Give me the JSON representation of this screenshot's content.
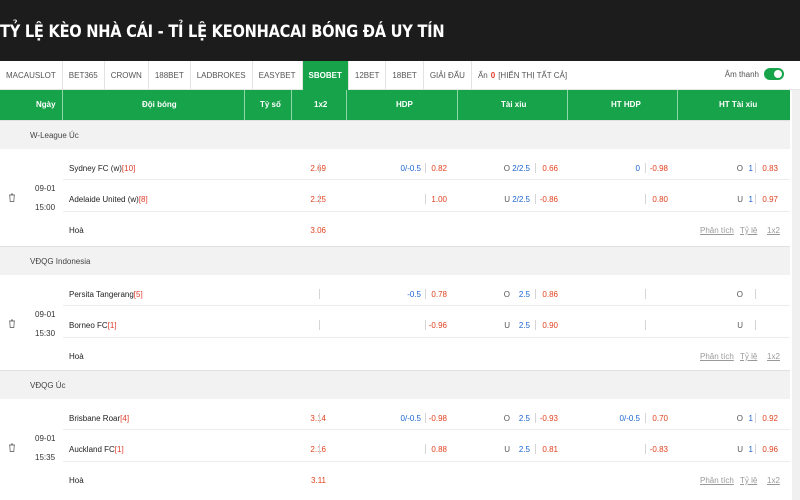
{
  "page": {
    "title": "TỶ LỆ KÈO NHÀ CÁI - TỈ LỆ KEONHACAI BÓNG ĐÁ UY TÍN"
  },
  "tabs": [
    "MACAUSLOT",
    "BET365",
    "CROWN",
    "188BET",
    "LADBROKES",
    "EASYBET",
    "SBOBET",
    "12BET",
    "18BET",
    "GIẢI ĐẤU"
  ],
  "hidden_tab": {
    "prefix": "Ẩn",
    "count": "0",
    "show_all": "[HIỂN THỊ TẤT CẢ]"
  },
  "sound": {
    "label": "Âm thanh",
    "on": true
  },
  "columns": {
    "date": "Ngày",
    "teams": "Đội bóng",
    "score": "Tỷ số",
    "x12": "1x2",
    "hdp": "HDP",
    "ou": "Tài xỉu",
    "hthdp": "HT HDP",
    "htou": "HT Tài xỉu"
  },
  "actions": {
    "analysis": "Phân tích",
    "odds": "Tỷ lệ",
    "x12": "1x2"
  },
  "leagues": [
    {
      "name": "W-League Úc",
      "date": "09-01",
      "time": "15:00",
      "home": {
        "name": "Sydney FC (w)",
        "rank": "[10]",
        "x12": "2.69",
        "hdp_line": "0/-0.5",
        "hdp_odds": "0.82",
        "ou_side": "O",
        "ou_line": "2/2.5",
        "ou_odds": "0.66",
        "hthdp_line": "0",
        "hthdp_odds": "-0.98",
        "htou_side": "O",
        "htou_line": "1",
        "htou_odds": "0.83"
      },
      "away": {
        "name": "Adelaide United (w)",
        "rank": "[8]",
        "x12": "2.25",
        "hdp_line": "",
        "hdp_odds": "1.00",
        "ou_side": "U",
        "ou_line": "2/2.5",
        "ou_odds": "-0.86",
        "hthdp_line": "",
        "hthdp_odds": "0.80",
        "htou_side": "U",
        "htou_line": "1",
        "htou_odds": "0.97"
      },
      "draw": {
        "name": "Hoà",
        "x12": "3.06"
      }
    },
    {
      "name": "VĐQG Indonesia",
      "date": "09-01",
      "time": "15:30",
      "home": {
        "name": "Persita Tangerang",
        "rank": "[5]",
        "x12": "",
        "hdp_line": "-0.5",
        "hdp_odds": "0.78",
        "ou_side": "O",
        "ou_line": "2.5",
        "ou_odds": "0.86",
        "hthdp_line": "",
        "hthdp_odds": "",
        "htou_side": "O",
        "htou_line": "",
        "htou_odds": ""
      },
      "away": {
        "name": "Borneo FC",
        "rank": "[1]",
        "x12": "",
        "hdp_line": "",
        "hdp_odds": "-0.96",
        "ou_side": "U",
        "ou_line": "2.5",
        "ou_odds": "0.90",
        "hthdp_line": "",
        "hthdp_odds": "",
        "htou_side": "U",
        "htou_line": "",
        "htou_odds": ""
      },
      "draw": {
        "name": "Hoà",
        "x12": ""
      }
    },
    {
      "name": "VĐQG Úc",
      "date": "09-01",
      "time": "15:35",
      "home": {
        "name": "Brisbane Roar",
        "rank": "[4]",
        "x12": "3.14",
        "hdp_line": "0/-0.5",
        "hdp_odds": "-0.98",
        "ou_side": "O",
        "ou_line": "2.5",
        "ou_odds": "-0.93",
        "hthdp_line": "0/-0.5",
        "hthdp_odds": "0.70",
        "htou_side": "O",
        "htou_line": "1",
        "htou_odds": "0.92"
      },
      "away": {
        "name": "Auckland FC",
        "rank": "[1]",
        "x12": "2.16",
        "hdp_line": "",
        "hdp_odds": "0.88",
        "ou_side": "U",
        "ou_line": "2.5",
        "ou_odds": "0.81",
        "hthdp_line": "",
        "hthdp_odds": "-0.83",
        "htou_side": "U",
        "htou_line": "1",
        "htou_odds": "0.96"
      },
      "draw": {
        "name": "Hoà",
        "x12": "3.11"
      }
    }
  ]
}
